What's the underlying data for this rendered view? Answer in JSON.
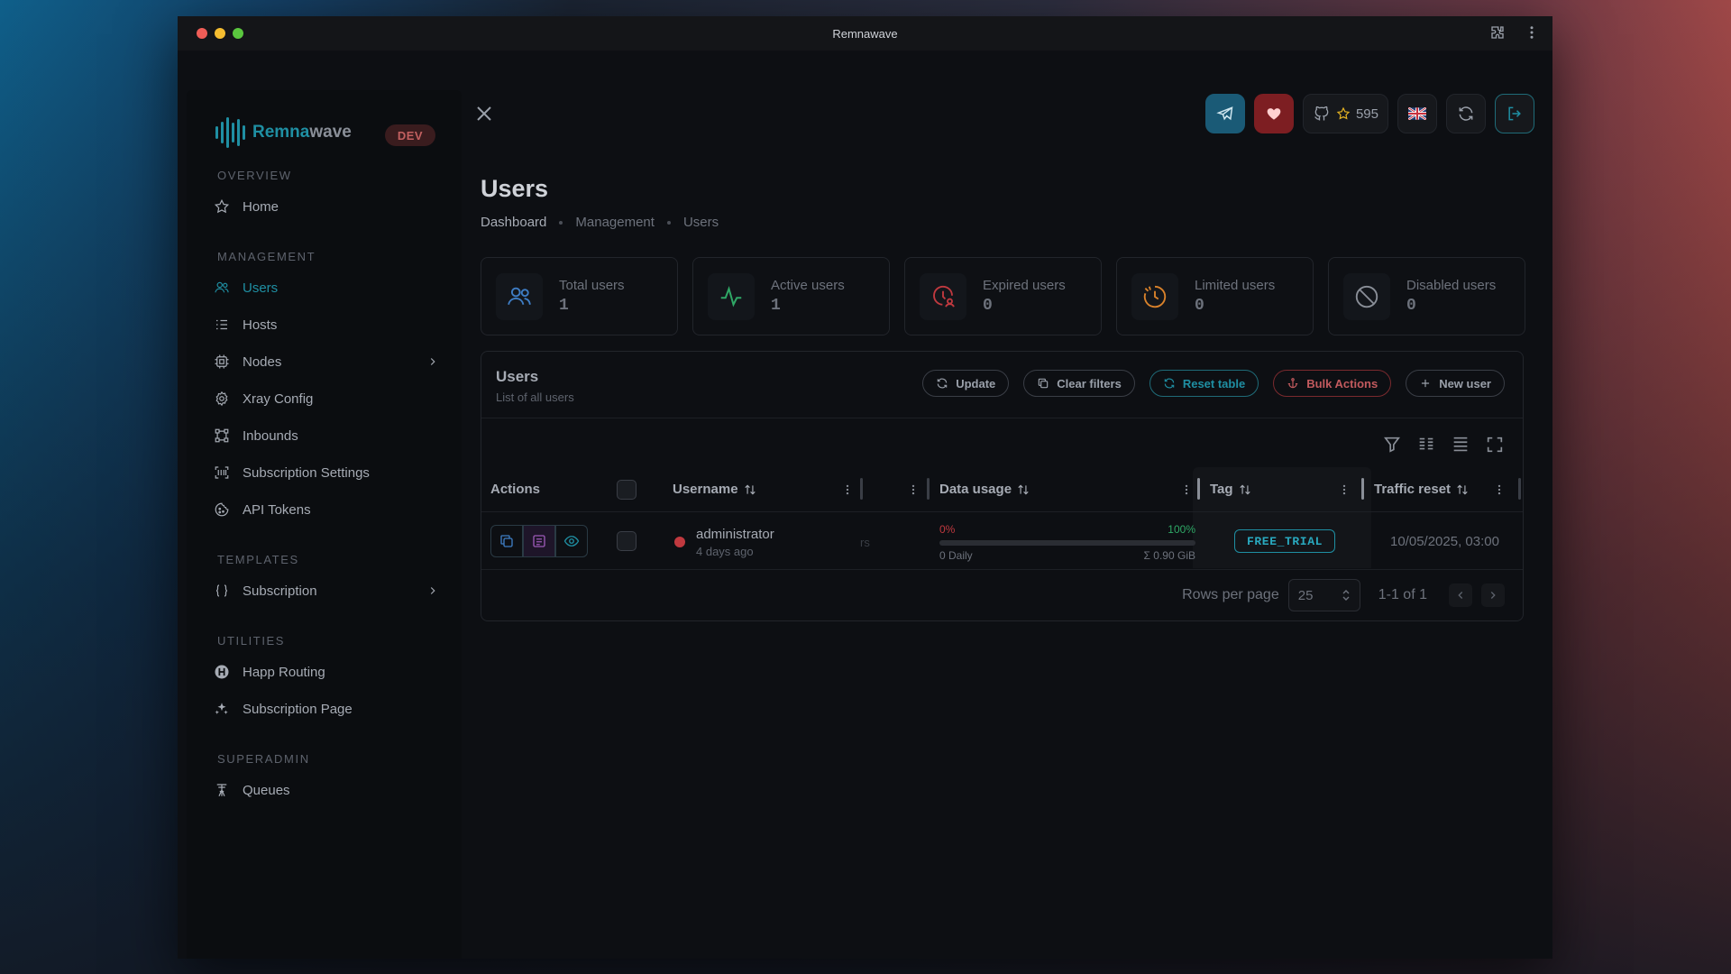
{
  "window": {
    "title": "Remnawave"
  },
  "brand": {
    "name_accent": "Remna",
    "name_rest": "wave",
    "badge": "DEV"
  },
  "sidebar": {
    "sections": {
      "overview": "OVERVIEW",
      "management": "MANAGEMENT",
      "templates": "TEMPLATES",
      "utilities": "UTILITIES",
      "superadmin": "SUPERADMIN"
    },
    "items": {
      "home": "Home",
      "users": "Users",
      "hosts": "Hosts",
      "nodes": "Nodes",
      "xray": "Xray Config",
      "inbounds": "Inbounds",
      "subscription_settings": "Subscription Settings",
      "api_tokens": "API Tokens",
      "subscription": "Subscription",
      "happ_routing": "Happ Routing",
      "subscription_page": "Subscription Page",
      "queues": "Queues"
    },
    "active_item": "Users"
  },
  "header": {
    "github_stars": "595",
    "accent": "#1f8fa3"
  },
  "page": {
    "title": "Users",
    "breadcrumb": [
      "Dashboard",
      "Management",
      "Users"
    ]
  },
  "stats": [
    {
      "label": "Total users",
      "value": "1",
      "icon": "users-icon",
      "color": "#3e7dc4"
    },
    {
      "label": "Active users",
      "value": "1",
      "icon": "activity-icon",
      "color": "#2fa866"
    },
    {
      "label": "Expired users",
      "value": "0",
      "icon": "clock-user-icon",
      "color": "#c0393f"
    },
    {
      "label": "Limited users",
      "value": "0",
      "icon": "clock-limit-icon",
      "color": "#d9822b"
    },
    {
      "label": "Disabled users",
      "value": "0",
      "icon": "ban-icon",
      "color": "#8a8f98"
    }
  ],
  "panel": {
    "title": "Users",
    "subtitle": "List of all users",
    "buttons": {
      "update": "Update",
      "clear_filters": "Clear filters",
      "reset_table": "Reset table",
      "bulk_actions": "Bulk Actions",
      "new_user": "New user"
    }
  },
  "table": {
    "columns": {
      "actions": "Actions",
      "username": "Username",
      "data_usage": "Data usage",
      "tag": "Tag",
      "traffic_reset": "Traffic reset"
    },
    "rows": [
      {
        "username": "administrator",
        "created": "4 days ago",
        "status_color": "#c0393f",
        "ghost_text": "rs",
        "usage_low": "0%",
        "usage_high": "100%",
        "usage_fraction": 0,
        "usage_reset": "0 Daily",
        "usage_total": "Σ 0.90 GiB",
        "tag": "FREE_TRIAL",
        "traffic_reset": "10/05/2025, 03:00"
      }
    ]
  },
  "pagination": {
    "rows_per_page_label": "Rows per page",
    "rows_per_page": "25",
    "range": "1-1 of 1"
  }
}
